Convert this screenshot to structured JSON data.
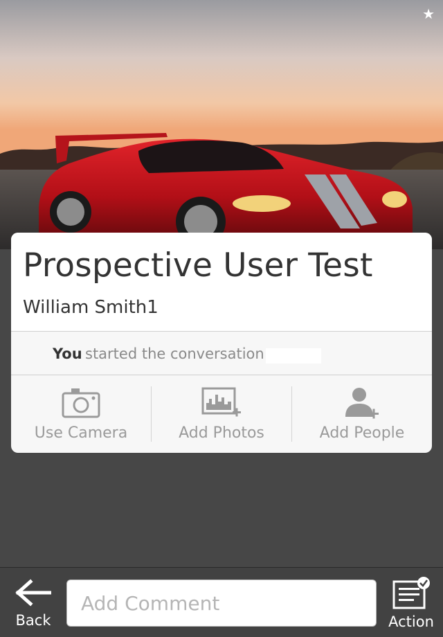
{
  "hero": {
    "image_name": "red-sports-car-photo",
    "star_icon": "★"
  },
  "conversation": {
    "title": "Prospective User Test",
    "participant": "William Smith1",
    "status_you": "You",
    "status_text": "started the conversation"
  },
  "actions": [
    {
      "label": "Use Camera",
      "icon": "camera-icon"
    },
    {
      "label": "Add Photos",
      "icon": "add-photos-icon"
    },
    {
      "label": "Add People",
      "icon": "add-person-icon"
    }
  ],
  "bottom_bar": {
    "back_label": "Back",
    "comment_placeholder": "Add Comment",
    "action_label": "Action"
  },
  "colors": {
    "background": "#474747",
    "card": "#f7f7f7",
    "muted_text": "#9a9a9a",
    "car_red": "#c8141c"
  }
}
